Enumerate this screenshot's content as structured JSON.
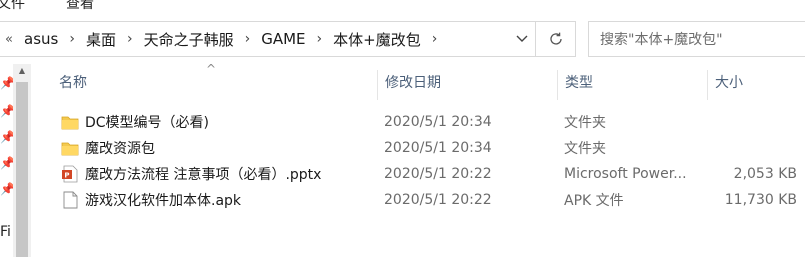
{
  "menu": {
    "item_1": "文件",
    "item_2": "查看"
  },
  "address_bar": {
    "lead_icon": "chevron-double-left-icon",
    "crumbs": [
      "asus",
      "桌面",
      "天命之子韩服",
      "GAME",
      "本体+魔改包"
    ]
  },
  "search": {
    "placeholder": "搜索\"本体+魔改包\""
  },
  "nav_pane": {
    "partial_label": "Fi"
  },
  "columns": {
    "name": "名称",
    "date": "修改日期",
    "type": "类型",
    "size": "大小"
  },
  "files": [
    {
      "icon": "folder-icon",
      "name": "DC模型编号（必看)",
      "date": "2020/5/1 20:34",
      "type": "文件夹",
      "size": ""
    },
    {
      "icon": "folder-icon",
      "name": "魔改资源包",
      "date": "2020/5/1 20:34",
      "type": "文件夹",
      "size": ""
    },
    {
      "icon": "pptx-file-icon",
      "name": "魔改方法流程 注意事项（必看）.pptx",
      "date": "2020/5/1 20:22",
      "type": "Microsoft Power...",
      "size": "2,053 KB"
    },
    {
      "icon": "apk-file-icon",
      "name": "游戏汉化软件加本体.apk",
      "date": "2020/5/1 20:22",
      "type": "APK 文件",
      "size": "11,730 KB"
    }
  ]
}
